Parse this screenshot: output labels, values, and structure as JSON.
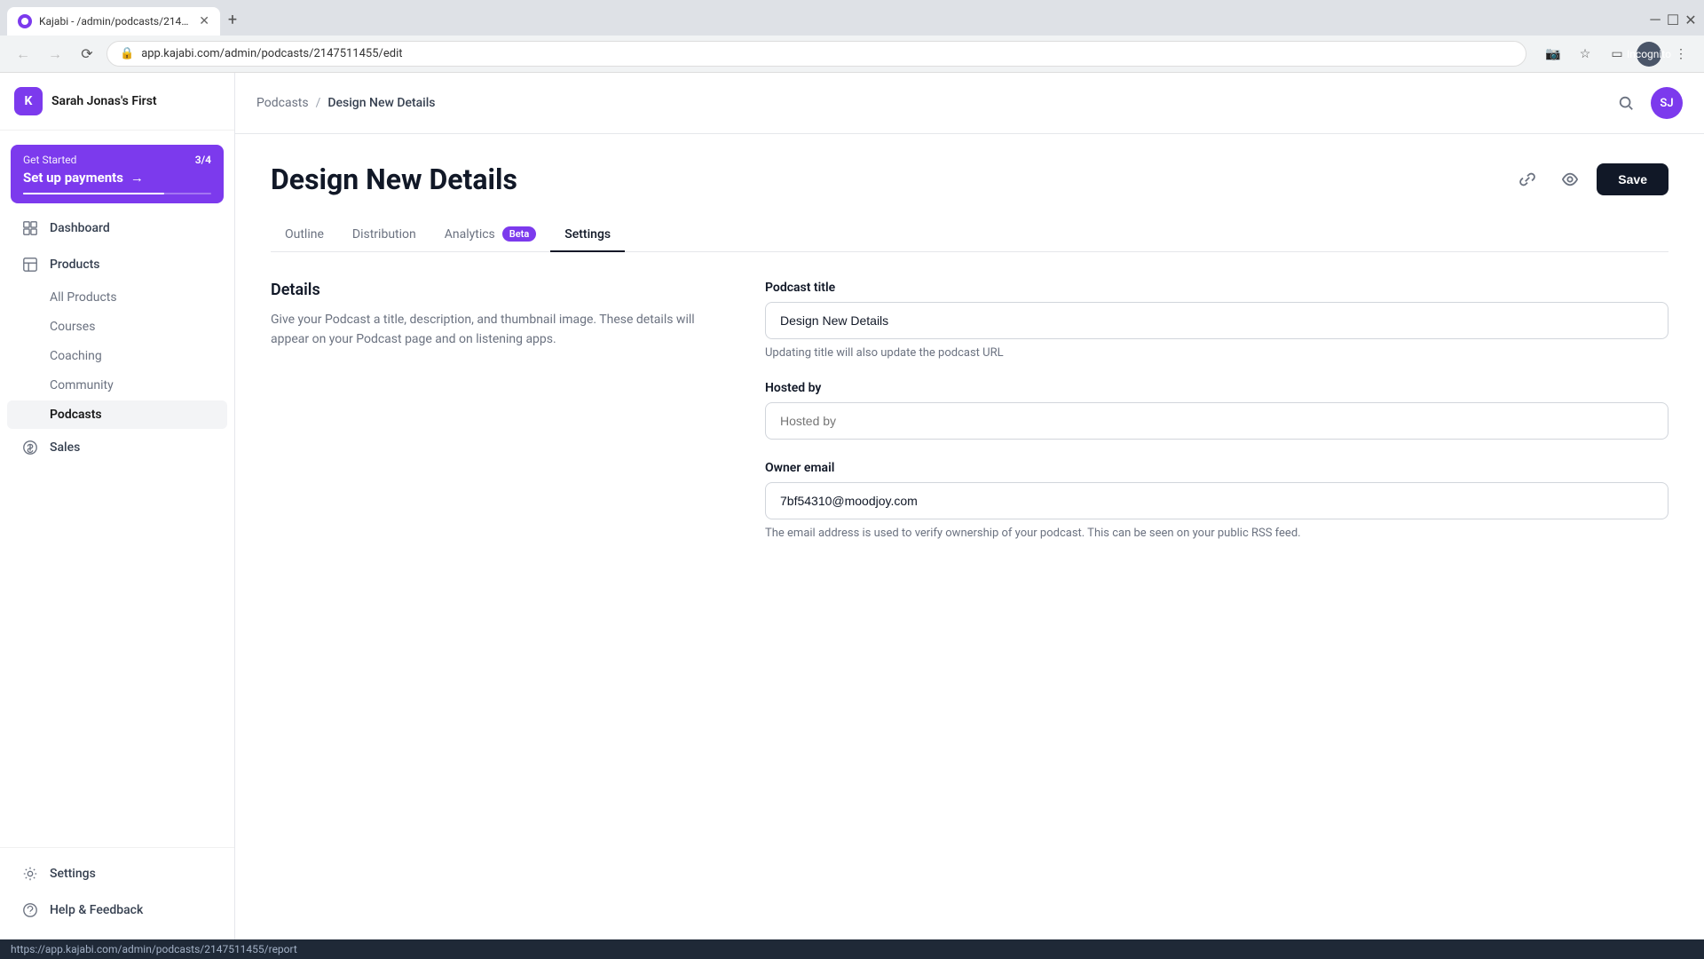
{
  "browser": {
    "tab_title": "Kajabi - /admin/podcasts/21475...",
    "url": "app.kajabi.com/admin/podcasts/2147511455/edit",
    "loading": true,
    "profile_text": "Incognito"
  },
  "sidebar": {
    "logo_text": "K",
    "brand_name": "Sarah Jonas's First",
    "get_started": {
      "label": "Get Started",
      "count": "3/4",
      "title": "Set up payments",
      "progress_percent": 75
    },
    "nav_items": [
      {
        "id": "dashboard",
        "label": "Dashboard"
      },
      {
        "id": "products",
        "label": "Products"
      },
      {
        "id": "sales",
        "label": "Sales"
      },
      {
        "id": "settings",
        "label": "Settings"
      },
      {
        "id": "help",
        "label": "Help & Feedback"
      }
    ],
    "sub_items": [
      {
        "id": "all-products",
        "label": "All Products",
        "active": false
      },
      {
        "id": "courses",
        "label": "Courses",
        "active": false
      },
      {
        "id": "coaching",
        "label": "Coaching",
        "active": false
      },
      {
        "id": "community",
        "label": "Community",
        "active": false
      },
      {
        "id": "podcasts",
        "label": "Podcasts",
        "active": true
      }
    ]
  },
  "topbar": {
    "breadcrumb": {
      "parent": "Podcasts",
      "separator": "/",
      "current": "Design New Details"
    },
    "avatar_text": "SJ"
  },
  "page": {
    "title": "Design New Details",
    "tabs": [
      {
        "id": "outline",
        "label": "Outline",
        "active": false
      },
      {
        "id": "distribution",
        "label": "Distribution",
        "active": false
      },
      {
        "id": "analytics",
        "label": "Analytics",
        "active": false,
        "badge": "Beta"
      },
      {
        "id": "settings",
        "label": "Settings",
        "active": true
      }
    ],
    "save_button": "Save"
  },
  "form": {
    "section_title": "Details",
    "section_description": "Give your Podcast a title, description, and thumbnail image. These details will appear on your Podcast page and on listening apps.",
    "fields": {
      "podcast_title": {
        "label": "Podcast title",
        "value": "Design New Details",
        "placeholder": ""
      },
      "hosted_by": {
        "label": "Hosted by",
        "value": "",
        "placeholder": "Hosted by"
      },
      "owner_email": {
        "label": "Owner email",
        "value": "7bf54310@moodjoy.com",
        "placeholder": ""
      },
      "owner_email_hint": "The email address is used to verify ownership of your podcast. This can be seen on your public RSS feed."
    },
    "update_url_hint": "Updating title will also update the podcast URL"
  },
  "status_bar": {
    "url": "https://app.kajabi.com/admin/podcasts/2147511455/report"
  }
}
